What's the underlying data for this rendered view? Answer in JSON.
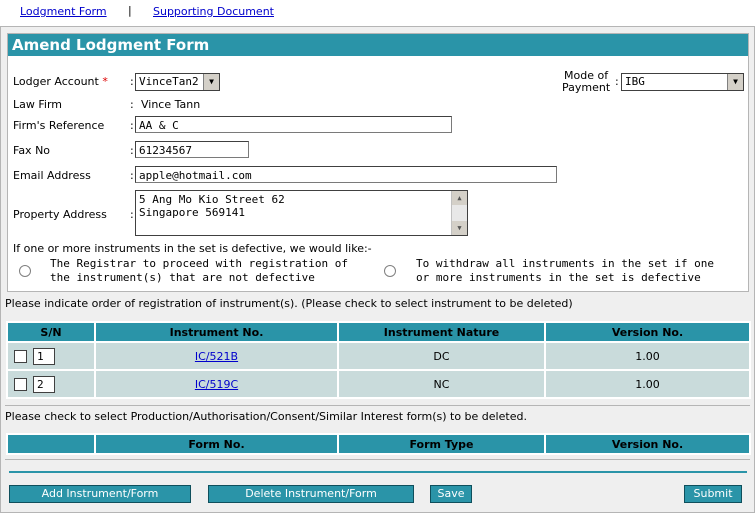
{
  "tabs": {
    "lodgment_form": "Lodgment Form",
    "separator": "|",
    "supporting_document": "Supporting Document"
  },
  "form": {
    "title": "Amend Lodgment Form",
    "colon": ":",
    "lodger_account": {
      "label": "Lodger Account",
      "required": "*",
      "value": "VinceTan2"
    },
    "mode_of_payment": {
      "label_line1": "Mode of",
      "label_line2": "Payment",
      "value": "IBG"
    },
    "law_firm": {
      "label": "Law Firm",
      "value": "Vince Tann"
    },
    "firms_reference": {
      "label": "Firm's Reference",
      "value": "AA & C"
    },
    "fax_no": {
      "label": "Fax No",
      "value": "61234567"
    },
    "email": {
      "label": "Email Address",
      "value": "apple@hotmail.com"
    },
    "property_address": {
      "label": "Property Address",
      "line1": "5 Ang Mo Kio Street 62",
      "line2": "Singapore 569141"
    },
    "defective_prompt": "If one or more instruments in the set is defective, we would like:-",
    "option1": {
      "line1": "The Registrar to proceed with registration of",
      "line2": "the instrument(s) that are not defective"
    },
    "option2": {
      "line1": "To withdraw all instruments in the set if one",
      "line2": "or more instruments in the set is defective"
    }
  },
  "instruments": {
    "note": "Please indicate order of registration of instrument(s). (Please check to select instrument to be deleted)",
    "headers": [
      "S/N",
      "Instrument No.",
      "Instrument Nature",
      "Version No."
    ],
    "rows": [
      {
        "sn": "1",
        "no": "IC/521B",
        "nature": "DC",
        "version": "1.00"
      },
      {
        "sn": "2",
        "no": "IC/519C",
        "nature": "NC",
        "version": "1.00"
      }
    ]
  },
  "forms": {
    "note": "Please check to select Production/Authorisation/Consent/Similar Interest form(s) to be deleted.",
    "headers": [
      "",
      "Form No.",
      "Form Type",
      "Version No."
    ]
  },
  "buttons": {
    "add": "Add Instrument/Form",
    "delete": "Delete Instrument/Form",
    "save": "Save",
    "submit": "Submit"
  },
  "colors": {
    "accent": "#2a94a8",
    "row_bg": "#c9dbdb",
    "link": "#0000cc"
  }
}
